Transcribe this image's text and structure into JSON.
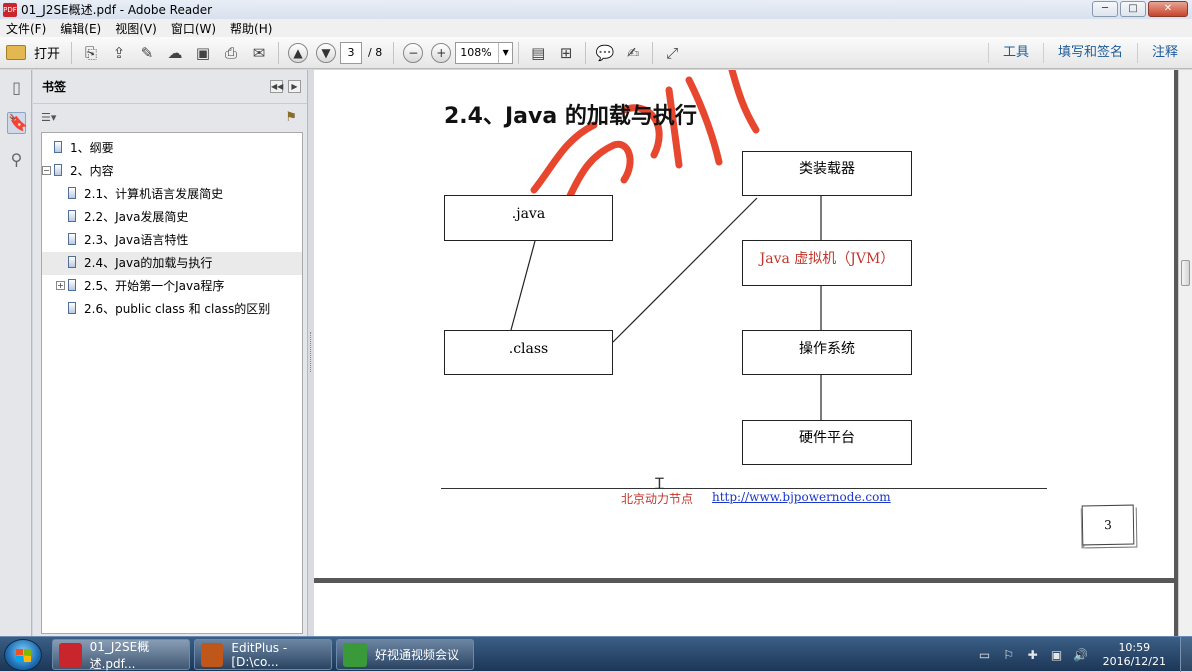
{
  "window": {
    "title": "01_J2SE概述.pdf - Adobe Reader",
    "app_icon": "pdf-icon",
    "controls": {
      "minimize": "─",
      "maximize": "□",
      "close": "✕"
    }
  },
  "menu": [
    "文件(F)",
    "编辑(E)",
    "视图(V)",
    "窗口(W)",
    "帮助(H)"
  ],
  "toolbar": {
    "open_label": "打开",
    "current_page": "3",
    "total_pages": "/ 8",
    "zoom": "108%",
    "right_tabs": [
      "工具",
      "填写和签名",
      "注释"
    ]
  },
  "bookmarks": {
    "panel_title": "书签",
    "items": [
      {
        "label": "1、纲要",
        "level": 0,
        "expander": "",
        "selected": false
      },
      {
        "label": "2、内容",
        "level": 0,
        "expander": "−",
        "selected": false
      },
      {
        "label": "2.1、计算机语言发展简史",
        "level": 1,
        "expander": "",
        "selected": false
      },
      {
        "label": "2.2、Java发展简史",
        "level": 1,
        "expander": "",
        "selected": false
      },
      {
        "label": "2.3、Java语言特性",
        "level": 1,
        "expander": "",
        "selected": false
      },
      {
        "label": "2.4、Java的加载与执行",
        "level": 1,
        "expander": "",
        "selected": true
      },
      {
        "label": "2.5、开始第一个Java程序",
        "level": 1,
        "expander": "+",
        "selected": false
      },
      {
        "label": "2.6、public class 和 class的区别",
        "level": 1,
        "expander": "",
        "selected": false
      }
    ]
  },
  "document": {
    "heading": "2.4、Java 的加载与执行",
    "boxes": {
      "java": ".java",
      "class": ".class",
      "classloader": "类装载器",
      "jvm": "Java 虚拟机（JVM）",
      "os": "操作系统",
      "hardware": "硬件平台"
    },
    "footer_org": "北京动力节点",
    "footer_url": "http://www.bjpowernode.com",
    "page_number": "3",
    "watermark_color": "#e8472f"
  },
  "taskbar": {
    "tasks": [
      {
        "label": "01_J2SE概述.pdf...",
        "icon": "pdf-icon",
        "active": true
      },
      {
        "label": "EditPlus - [D:\\co...",
        "icon": "editplus-icon",
        "active": false
      },
      {
        "label": "好视通视频会议",
        "icon": "video-conference-icon",
        "active": false
      }
    ],
    "time": "10:59",
    "date": "2016/12/21"
  }
}
